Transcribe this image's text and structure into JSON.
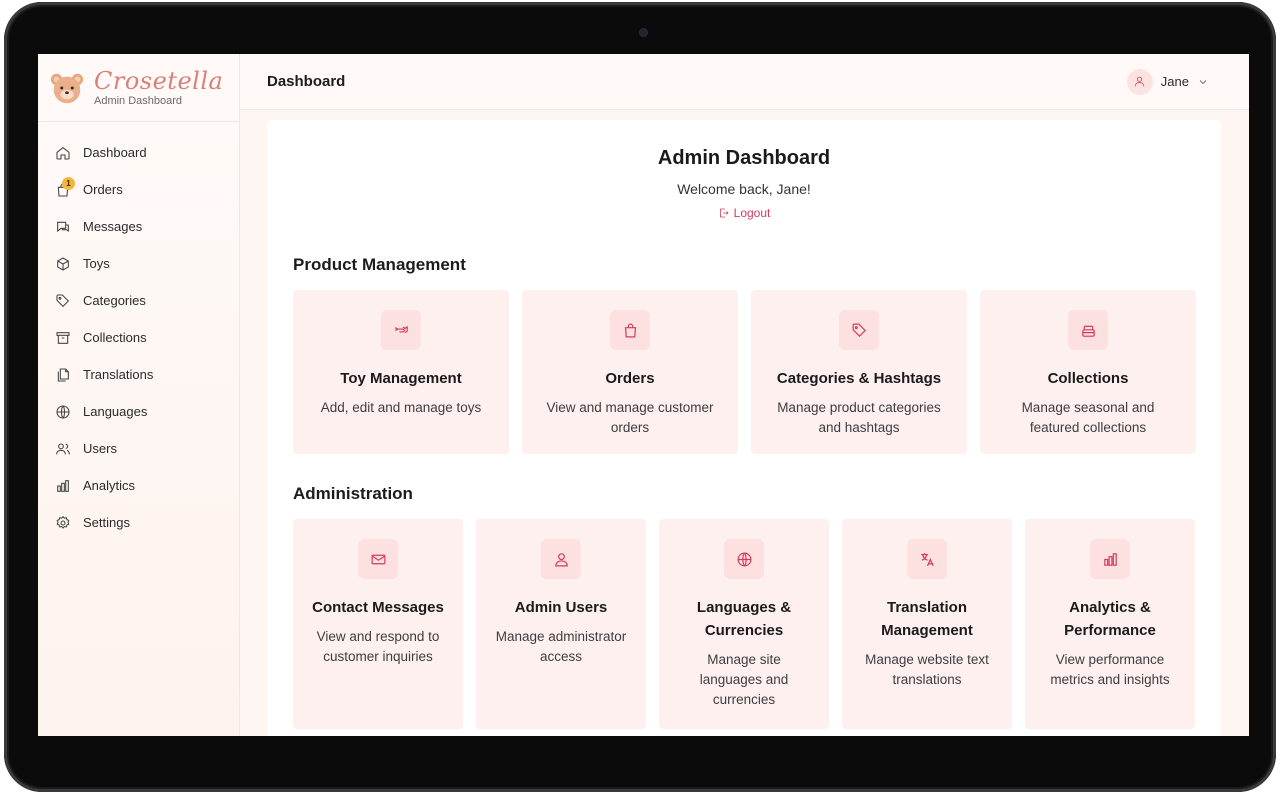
{
  "brand": {
    "name": "Crosetella",
    "subtitle": "Admin Dashboard"
  },
  "sidebar": {
    "items": [
      {
        "label": "Dashboard",
        "icon": "home-icon"
      },
      {
        "label": "Orders",
        "icon": "shopping-bag-icon",
        "badge": "1"
      },
      {
        "label": "Messages",
        "icon": "chat-icon"
      },
      {
        "label": "Toys",
        "icon": "box-icon"
      },
      {
        "label": "Categories",
        "icon": "tag-icon"
      },
      {
        "label": "Collections",
        "icon": "archive-icon"
      },
      {
        "label": "Translations",
        "icon": "files-icon"
      },
      {
        "label": "Languages",
        "icon": "globe-icon"
      },
      {
        "label": "Users",
        "icon": "users-icon"
      },
      {
        "label": "Analytics",
        "icon": "bar-chart-icon"
      },
      {
        "label": "Settings",
        "icon": "gear-icon"
      }
    ]
  },
  "header": {
    "title": "Dashboard",
    "user_name": "Jane"
  },
  "main": {
    "title": "Admin Dashboard",
    "welcome": "Welcome back, Jane!",
    "logout_label": "Logout",
    "sections": [
      {
        "title": "Product Management",
        "cards": [
          {
            "title": "Toy Management",
            "description": "Add, edit and manage toys",
            "icon": "toy-icon"
          },
          {
            "title": "Orders",
            "description": "View and manage customer orders",
            "icon": "shopping-bag-icon"
          },
          {
            "title": "Categories & Hashtags",
            "description": "Manage product categories and hashtags",
            "icon": "tag-icon"
          },
          {
            "title": "Collections",
            "description": "Manage seasonal and featured collections",
            "icon": "collection-icon"
          }
        ]
      },
      {
        "title": "Administration",
        "cards": [
          {
            "title": "Contact Messages",
            "description": "View and respond to customer inquiries",
            "icon": "mail-icon"
          },
          {
            "title": "Admin Users",
            "description": "Manage administrator access",
            "icon": "users-icon"
          },
          {
            "title": "Languages & Currencies",
            "description": "Manage site languages and currencies",
            "icon": "globe-icon"
          },
          {
            "title": "Translation Management",
            "description": "Manage website text translations",
            "icon": "translate-icon"
          },
          {
            "title": "Analytics & Performance",
            "description": "View performance metrics and insights",
            "icon": "bar-chart-icon"
          }
        ]
      }
    ]
  },
  "colors": {
    "accent": "#d23c5a",
    "card_bg": "#fff0f0",
    "icon_bg": "#fde0e0",
    "badge": "#f4b53f",
    "brand": "#d9807a"
  }
}
